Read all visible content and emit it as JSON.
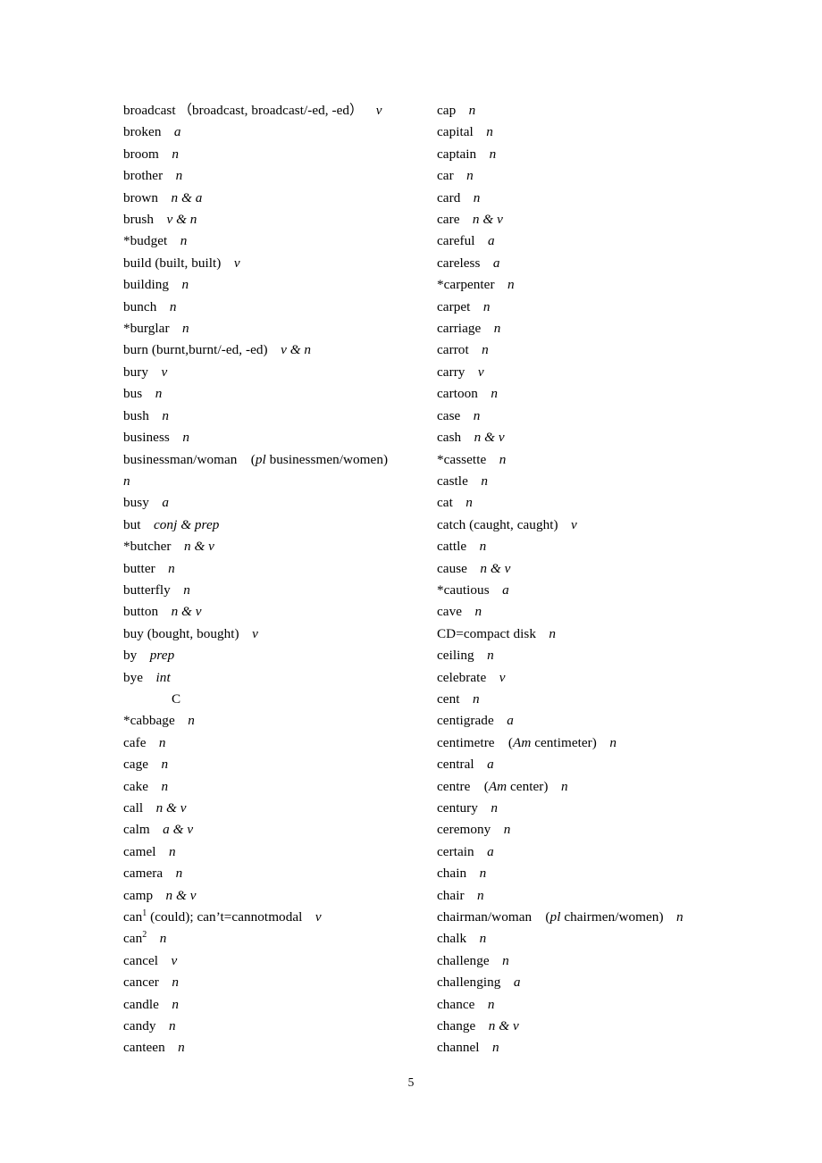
{
  "document": {
    "page_number": "5",
    "section_header": "C"
  },
  "columns": {
    "left": [
      {
        "word": "broadcast",
        "inflection": "（broadcast, broadcast/-ed, -ed）",
        "pos": "v"
      },
      {
        "word": "broken",
        "pos": "a"
      },
      {
        "word": "broom",
        "pos": "n"
      },
      {
        "word": "brother",
        "pos": "n"
      },
      {
        "word": "brown",
        "pos": "n & a"
      },
      {
        "word": "brush",
        "pos": "v & n"
      },
      {
        "word": "*budget",
        "pos": "n"
      },
      {
        "word": "build (built, built)",
        "pos": "v"
      },
      {
        "word": "building",
        "pos": "n"
      },
      {
        "word": "bunch",
        "pos": "n"
      },
      {
        "word": "*burglar",
        "pos": "n"
      },
      {
        "word": "burn (burnt,burnt/-ed, -ed)",
        "pos": "v & n"
      },
      {
        "word": "bury",
        "pos": "v"
      },
      {
        "word": "bus",
        "pos": "n"
      },
      {
        "word": "bush",
        "pos": "n"
      },
      {
        "word": "business",
        "pos": "n"
      },
      {
        "word": "businessman/woman",
        "paren_italic": "pl",
        "paren_rest": " businessmen/women)",
        "paren_open": "(",
        "pos": "",
        "wrap_pos": "n"
      },
      {
        "word": "busy",
        "pos": "a"
      },
      {
        "word": "but",
        "pos": "conj & prep"
      },
      {
        "word": "*butcher",
        "pos": "n & v"
      },
      {
        "word": "butter",
        "pos": "n"
      },
      {
        "word": "butterfly",
        "pos": "n"
      },
      {
        "word": "button",
        "pos": "n & v"
      },
      {
        "word": "buy (bought, bought)",
        "pos": "v"
      },
      {
        "word": "by",
        "pos": "prep"
      },
      {
        "word": "bye",
        "pos": "int"
      },
      {
        "section": "C"
      },
      {
        "word": "*cabbage",
        "pos": "n"
      },
      {
        "word": "cafe",
        "pos": "n"
      },
      {
        "word": "cage",
        "pos": "n"
      },
      {
        "word": "cake",
        "pos": "n"
      },
      {
        "word": "call",
        "pos": "n & v"
      },
      {
        "word": "calm",
        "pos": "a & v"
      },
      {
        "word": "camel",
        "pos": "n"
      },
      {
        "word": "camera",
        "pos": "n"
      },
      {
        "word": "camp",
        "pos": "n & v"
      },
      {
        "word": "can",
        "superscript": "1",
        "after": " (could); can’t=cannotmodal",
        "pos": "v"
      },
      {
        "word": "can",
        "superscript": "2",
        "pos": "n"
      },
      {
        "word": "cancel",
        "pos": "v"
      },
      {
        "word": "cancer",
        "pos": "n"
      },
      {
        "word": "candle",
        "pos": "n"
      },
      {
        "word": "candy",
        "pos": "n"
      },
      {
        "word": "canteen",
        "pos": "n"
      }
    ],
    "right": [
      {
        "word": "cap",
        "pos": "n"
      },
      {
        "word": "capital",
        "pos": "n"
      },
      {
        "word": "captain",
        "pos": "n"
      },
      {
        "word": "car",
        "pos": "n"
      },
      {
        "word": "card",
        "pos": "n"
      },
      {
        "word": "care",
        "pos": "n & v"
      },
      {
        "word": "careful",
        "pos": "a"
      },
      {
        "word": "careless",
        "pos": "a"
      },
      {
        "word": "*carpenter",
        "pos": "n"
      },
      {
        "word": "carpet",
        "pos": "n"
      },
      {
        "word": "carriage",
        "pos": "n"
      },
      {
        "word": "carrot",
        "pos": "n"
      },
      {
        "word": "carry",
        "pos": "v"
      },
      {
        "word": "cartoon",
        "pos": "n"
      },
      {
        "word": "case",
        "pos": "n"
      },
      {
        "word": "cash",
        "pos": "n & v"
      },
      {
        "word": "*cassette",
        "pos": "n"
      },
      {
        "word": "castle",
        "pos": "n"
      },
      {
        "word": "cat",
        "pos": "n"
      },
      {
        "word": "catch (caught, caught)",
        "pos": "v"
      },
      {
        "word": "cattle",
        "pos": "n"
      },
      {
        "word": "cause",
        "pos": "n & v"
      },
      {
        "word": "*cautious",
        "pos": "a"
      },
      {
        "word": "cave",
        "pos": "n"
      },
      {
        "word": "CD=compact disk",
        "pos": "n"
      },
      {
        "word": "ceiling",
        "pos": "n"
      },
      {
        "word": "celebrate",
        "pos": "v"
      },
      {
        "word": "cent",
        "pos": "n"
      },
      {
        "word": "centigrade",
        "pos": "a"
      },
      {
        "word": "centimetre",
        "paren_open": "(",
        "paren_italic": "Am",
        "paren_rest": " centimeter)",
        "pos": "n"
      },
      {
        "word": "central",
        "pos": "a"
      },
      {
        "word": "centre",
        "paren_open": "(",
        "paren_italic": "Am",
        "paren_rest": " center)",
        "pos": "n"
      },
      {
        "word": "century",
        "pos": "n"
      },
      {
        "word": "ceremony",
        "pos": "n"
      },
      {
        "word": "certain",
        "pos": "a"
      },
      {
        "word": "chain",
        "pos": "n"
      },
      {
        "word": "chair",
        "pos": "n"
      },
      {
        "word": "chairman/woman",
        "paren_open": "(",
        "paren_italic": "pl",
        "paren_rest": " chairmen/women)",
        "pos": "n"
      },
      {
        "word": "chalk",
        "pos": "n"
      },
      {
        "word": "challenge",
        "pos": "n"
      },
      {
        "word": "challenging",
        "pos": "a"
      },
      {
        "word": "chance",
        "pos": "n"
      },
      {
        "word": "change",
        "pos": "n & v"
      },
      {
        "word": "channel",
        "pos": "n"
      }
    ]
  }
}
